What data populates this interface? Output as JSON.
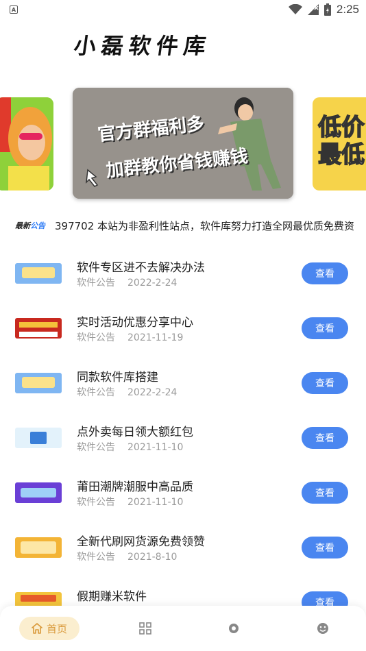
{
  "status_bar": {
    "time": "2:25",
    "notification_icon": "a-icon"
  },
  "app": {
    "title": "小磊软件库"
  },
  "carousel": {
    "center_line1": "官方群福利多",
    "center_line2": "加群教你省钱赚钱",
    "right_text": "低价 最低"
  },
  "notice": {
    "tag_prefix": "最新",
    "tag_highlight": "公告",
    "text": "397702 本站为非盈利性站点，软件库努力打造全网最优质免费资"
  },
  "list": {
    "button_label": "查看",
    "items": [
      {
        "title": "软件专区进不去解决办法",
        "category": "软件公告",
        "date": "2022-2-24",
        "thumb_color": "#7fb6f2"
      },
      {
        "title": "实时活动优惠分享中心",
        "category": "软件公告",
        "date": "2021-11-19",
        "thumb_color": "#c8291f"
      },
      {
        "title": "同款软件库搭建",
        "category": "软件公告",
        "date": "2022-2-24",
        "thumb_color": "#7fb6f2"
      },
      {
        "title": "点外卖每日领大额红包",
        "category": "软件公告",
        "date": "2021-11-10",
        "thumb_color": "#bfe3f7"
      },
      {
        "title": "莆田潮牌潮服中高品质",
        "category": "软件公告",
        "date": "2021-11-10",
        "thumb_color": "#6a3fd6"
      },
      {
        "title": "全新代刷网货源免费领赞",
        "category": "软件公告",
        "date": "2021-8-10",
        "thumb_color": "#f3b436"
      },
      {
        "title": "假期赚米软件",
        "category": "",
        "date": "",
        "thumb_color": "#e65a2a"
      }
    ]
  },
  "tabbar": {
    "home_label": "首页",
    "tabs": [
      "home-icon",
      "grid-icon",
      "discover-icon",
      "smile-icon"
    ],
    "accent": "#d9993a",
    "accent_bg": "#fbeecf"
  },
  "colors": {
    "primary_button": "#4a86f0"
  }
}
